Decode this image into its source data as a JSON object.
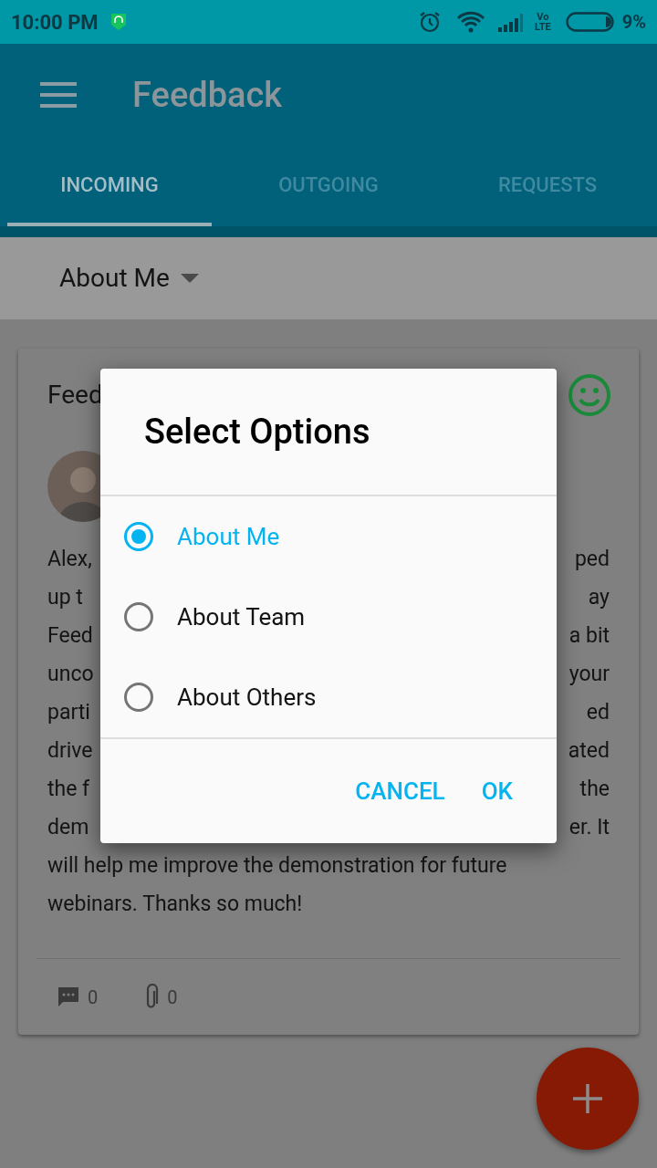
{
  "status_bar": {
    "time": "10:00 PM",
    "volte_top": "Vo",
    "volte_bottom": "LTE",
    "battery": "9%"
  },
  "app_bar": {
    "title": "Feedback"
  },
  "tabs": [
    {
      "label": "INCOMING",
      "selected": true
    },
    {
      "label": "OUTGOING",
      "selected": false
    },
    {
      "label": "REQUESTS",
      "selected": false
    }
  ],
  "filter": {
    "value": "About Me"
  },
  "card": {
    "title": "Feed",
    "body_lines": [
      {
        "left": "Alex,",
        "right": "ped"
      },
      {
        "left": "up t",
        "right": "ay"
      },
      {
        "left": "Feed",
        "right": "a bit"
      },
      {
        "left": "unco",
        "right": "your"
      },
      {
        "left": "parti",
        "right": "ed"
      },
      {
        "left": "drive",
        "right": "ated"
      },
      {
        "left": "the f",
        "right": "the"
      },
      {
        "left": "dem",
        "right": "er. It"
      },
      {
        "left": "will help me improve the demonstration for future"
      },
      {
        "left": "webinars. Thanks so much!"
      }
    ],
    "comments": "0",
    "attachments": "0"
  },
  "dialog": {
    "title": "Select Options",
    "options": [
      {
        "label": "About Me",
        "selected": true
      },
      {
        "label": "About Team",
        "selected": false
      },
      {
        "label": "About Others",
        "selected": false
      }
    ],
    "buttons": [
      "CANCEL",
      "OK"
    ]
  }
}
